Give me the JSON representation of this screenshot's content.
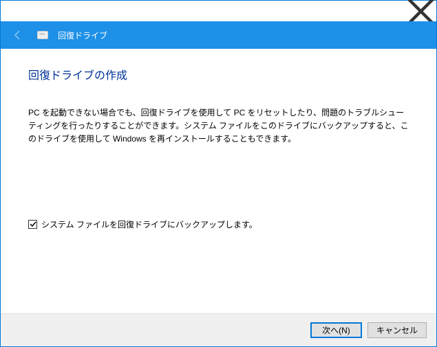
{
  "header": {
    "app_title": "回復ドライブ"
  },
  "main": {
    "page_title": "回復ドライブの作成",
    "description": "PC を起動できない場合でも、回復ドライブを使用して PC をリセットしたり、問題のトラブルシューティングを行ったりすることができます。システム ファイルをこのドライブにバックアップすると、このドライブを使用して Windows を再インストールすることもできます。",
    "checkbox_label": "システム ファイルを回復ドライブにバックアップします。",
    "checkbox_checked": true
  },
  "footer": {
    "next_label": "次へ(N)",
    "cancel_label": "キャンセル"
  }
}
